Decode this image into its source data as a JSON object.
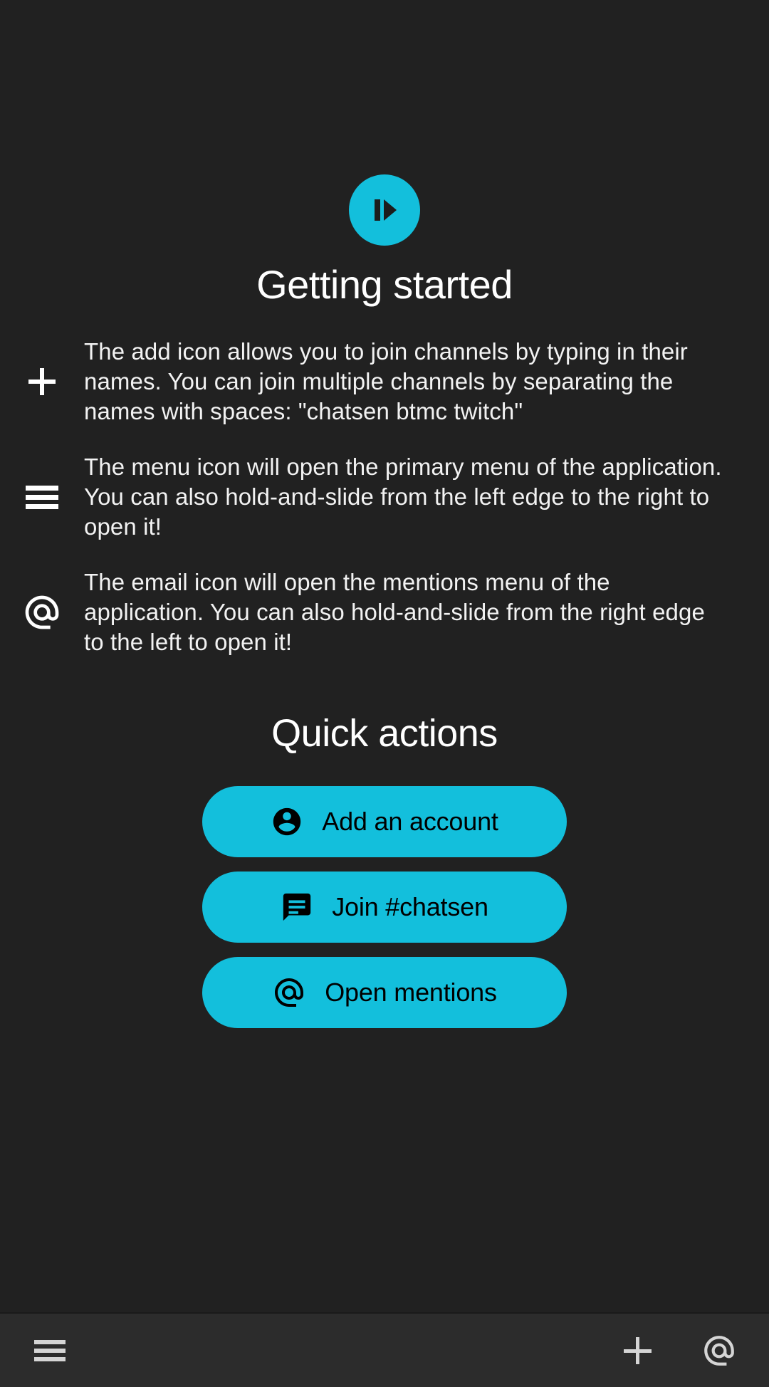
{
  "app": {
    "logo_icon": "chatsen-play-logo-icon",
    "accent_color": "#13BFDC",
    "background_color": "#212121",
    "bottom_bar_color": "#2C2C2C"
  },
  "header": {
    "title": "Getting started"
  },
  "tips": [
    {
      "icon": "add-icon",
      "text": "The add icon allows you to join channels by typing in their names. You can join multiple channels by separating the names with spaces: \"chatsen btmc twitch\""
    },
    {
      "icon": "menu-icon",
      "text": "The menu icon will open the primary menu of the application. You can also hold-and-slide from the left edge to the right to open it!"
    },
    {
      "icon": "at-icon",
      "text": "The email icon will open the mentions menu of the application. You can also hold-and-slide from the right edge to the left to open it!"
    }
  ],
  "quick_actions": {
    "title": "Quick actions",
    "buttons": [
      {
        "icon": "account-circle-icon",
        "label": "Add an account"
      },
      {
        "icon": "chat-bubble-icon",
        "label": "Join #chatsen"
      },
      {
        "icon": "at-icon",
        "label": "Open mentions"
      }
    ]
  },
  "bottom_bar": {
    "menu_icon": "menu-icon",
    "add_icon": "add-icon",
    "mentions_icon": "at-icon"
  }
}
